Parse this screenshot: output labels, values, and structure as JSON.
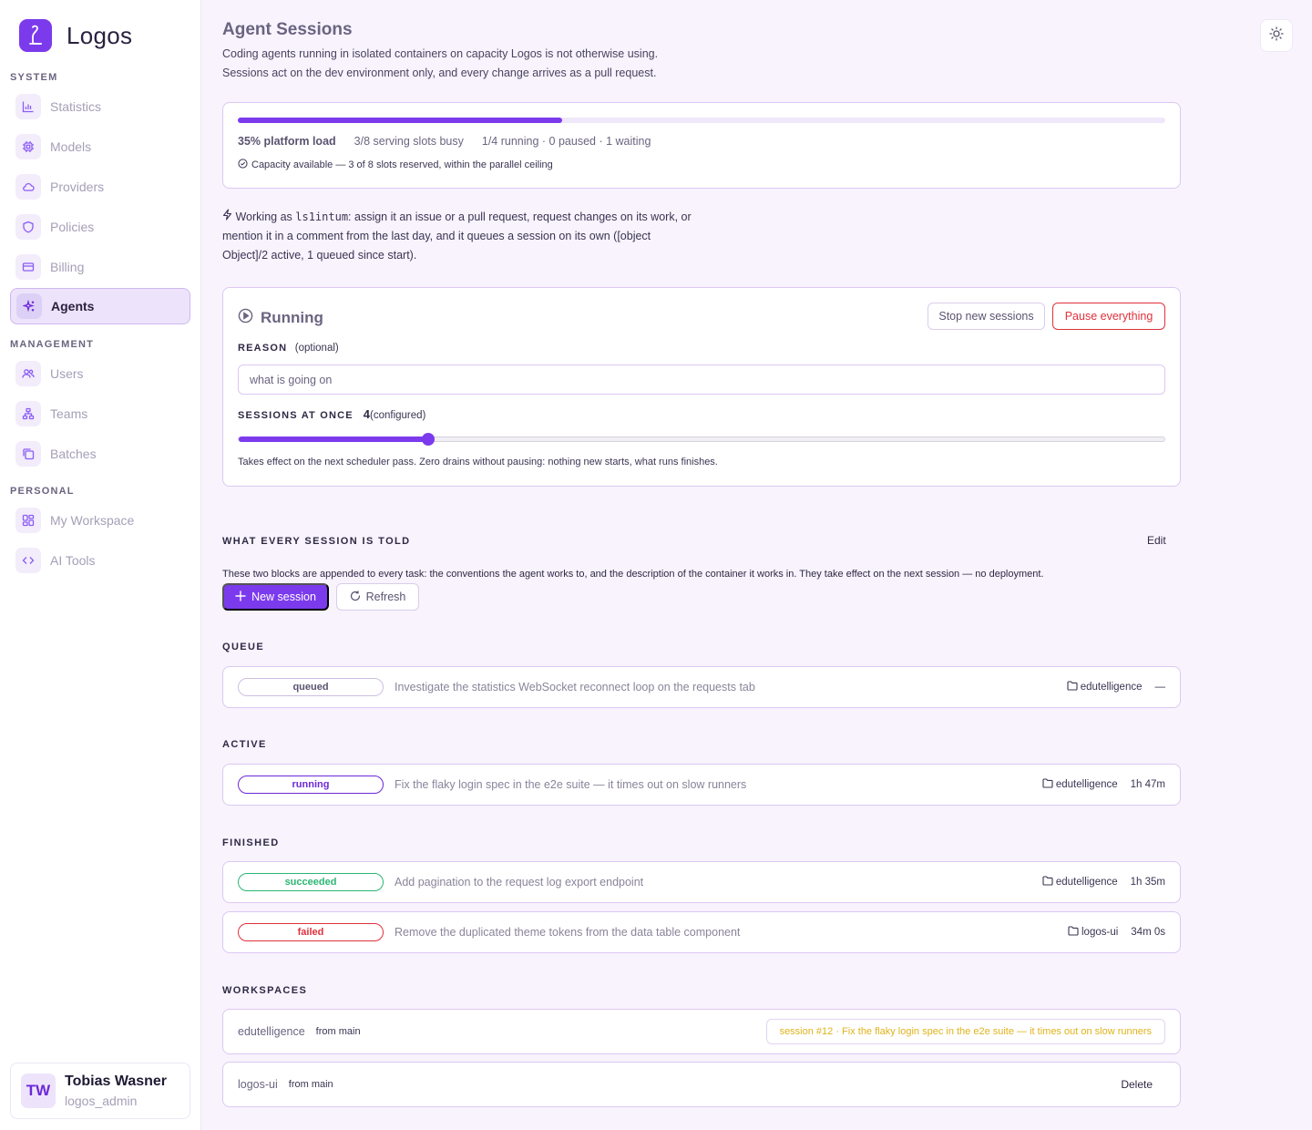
{
  "sidebar": {
    "brand": "Logos",
    "sections": {
      "system": "SYSTEM",
      "management": "MANAGEMENT",
      "personal": "PERSONAL"
    },
    "items": {
      "statistics": "Statistics",
      "models": "Models",
      "providers": "Providers",
      "policies": "Policies",
      "billing": "Billing",
      "agents": "Agents",
      "users": "Users",
      "teams": "Teams",
      "batches": "Batches",
      "workspace": "My Workspace",
      "ai_tools": "AI Tools"
    },
    "user": {
      "initials": "TW",
      "name": "Tobias Wasner",
      "handle": "logos_admin"
    }
  },
  "header": {
    "title": "Agent Sessions",
    "desc1": "Coding agents running in isolated containers on capacity Logos is not otherwise using.",
    "desc2": "Sessions act on the dev environment only, and every change arrives as a pull request."
  },
  "load": {
    "fraction": 0.35,
    "platform": "35% platform load",
    "slots": "3/8 serving slots busy",
    "sessions": "1/4 running · 0 paused · 1 waiting",
    "note": "Capacity available — 3 of 8 slots reserved, within the parallel ceiling"
  },
  "working": {
    "prefix": "Working as ",
    "handle": "ls1intum",
    "rest": ": assign it an issue or a pull request, request changes on its work, or mention it in a comment from the last day, and it queues a session on its own ([object Object]/2 active, 1 queued since start)."
  },
  "control": {
    "state": "Running",
    "stop_label": "Stop new sessions",
    "pause_label": "Pause everything",
    "reason_label": "REASON",
    "reason_hint": "(optional)",
    "reason_placeholder": "what is going on",
    "sessions_label": "SESSIONS AT ONCE",
    "sessions_value": "4",
    "sessions_hint": "(configured)",
    "slider_fraction": 0.205,
    "note": "Takes effect on the next scheduler pass. Zero drains without pausing: nothing new starts, what runs finishes."
  },
  "prompt": {
    "label": "WHAT EVERY SESSION IS TOLD",
    "edit_label": "Edit",
    "desc": "These two blocks are appended to every task: the conventions the agent works to, and the description of the container it works in. They take effect on the next session — no deployment."
  },
  "actions": {
    "new_session": "New session",
    "refresh": "Refresh"
  },
  "queue": {
    "label": "QUEUE",
    "items": [
      {
        "status": "queued",
        "title": "Investigate the statistics WebSocket reconnect loop on the requests tab",
        "repo": "edutelligence",
        "duration": "—"
      }
    ]
  },
  "active": {
    "label": "ACTIVE",
    "items": [
      {
        "status": "running",
        "title": "Fix the flaky login spec in the e2e suite — it times out on slow runners",
        "repo": "edutelligence",
        "duration": "1h 47m"
      }
    ]
  },
  "finished": {
    "label": "FINISHED",
    "items": [
      {
        "status": "succeeded",
        "title": "Add pagination to the request log export endpoint",
        "repo": "edutelligence",
        "duration": "1h 35m"
      },
      {
        "status": "failed",
        "title": "Remove the duplicated theme tokens from the data table component",
        "repo": "logos-ui",
        "duration": "34m 0s"
      }
    ]
  },
  "workspaces": {
    "label": "WORKSPACES",
    "items": [
      {
        "name": "edutelligence",
        "from": "from main",
        "session": "session #12 · Fix the flaky login spec in the e2e suite — it times out on slow runners"
      },
      {
        "name": "logos-ui",
        "from": "from main",
        "delete_label": "Delete"
      }
    ]
  },
  "colors": {
    "accent": "#7c3aed",
    "queued": "#5a5370",
    "running": "#6d28d9",
    "succeeded": "#2bb673",
    "failed": "#e0313b",
    "session_warning": "#e0b21b"
  },
  "icons": {
    "brand": "logos-logo-icon",
    "theme": "sun-icon",
    "repo": "folder-icon"
  }
}
